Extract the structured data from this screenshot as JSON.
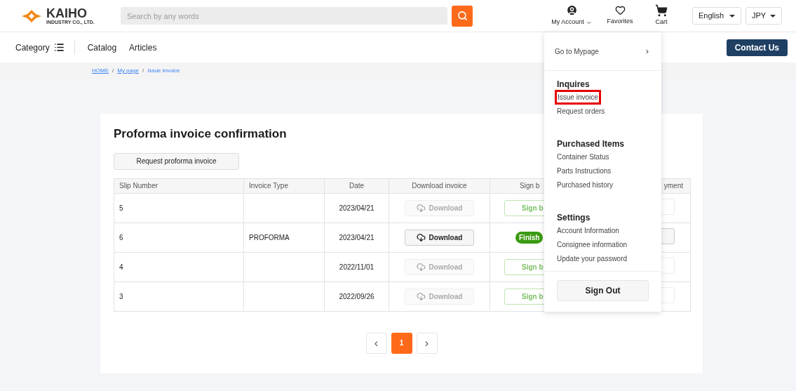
{
  "header": {
    "logo": {
      "name": "KAIHO",
      "subtitle": "INDUSTRY CO., LTD."
    },
    "search": {
      "placeholder": "Search by any words"
    },
    "account": {
      "label": "My Account",
      "expanded": true
    },
    "favorites": {
      "label": "Favorites"
    },
    "cart": {
      "label": "Cart"
    },
    "language": "English",
    "currency": "JPY"
  },
  "nav": {
    "category": "Category",
    "links": [
      "Catalog",
      "Articles"
    ],
    "contact": "Contact Us"
  },
  "breadcrumb_separator": "/",
  "breadcrumb": [
    {
      "label": "HOME",
      "link": true
    },
    {
      "label": "My page",
      "link": true
    },
    {
      "label": "Issue invoice",
      "link": false
    }
  ],
  "title": "Proforma invoice confirmation",
  "request_button": "Request proforma invoice",
  "table": {
    "columns": [
      "Slip Number",
      "Invoice Type",
      "Date",
      "Download invoice",
      "Sign b",
      "yment"
    ],
    "rows": [
      {
        "slip": "5",
        "type": "",
        "date": "2023/04/21",
        "download": {
          "label": "Download",
          "disabled": true
        },
        "sign": {
          "kind": "button",
          "label": "Sign b"
        },
        "payment_disabled": true
      },
      {
        "slip": "6",
        "type": "PROFORMA",
        "date": "2023/04/21",
        "download": {
          "label": "Download",
          "disabled": false
        },
        "sign": {
          "kind": "badge",
          "label": "Finish"
        },
        "payment_disabled": false
      },
      {
        "slip": "4",
        "type": "",
        "date": "2022/11/01",
        "download": {
          "label": "Download",
          "disabled": true
        },
        "sign": {
          "kind": "button",
          "label": "Sign b"
        },
        "payment_disabled": true
      },
      {
        "slip": "3",
        "type": "",
        "date": "2022/09/26",
        "download": {
          "label": "Download",
          "disabled": true
        },
        "sign": {
          "kind": "button",
          "label": "Sign b"
        },
        "payment_disabled": true
      }
    ]
  },
  "pagination": {
    "prev": "‹",
    "pages": [
      {
        "label": "1",
        "selected": true
      }
    ],
    "next": "›"
  },
  "menu": {
    "top": {
      "label": "Go to Mypage",
      "arrow": "›"
    },
    "sections": [
      {
        "title": "Inquires",
        "items": [
          {
            "label": "Issue invoice",
            "highlighted": true
          },
          {
            "label": "Request orders",
            "highlighted": false
          }
        ]
      },
      {
        "title": "Purchased Items",
        "items": [
          {
            "label": "Container Status",
            "highlighted": false
          },
          {
            "label": "Parts Instructions",
            "highlighted": false
          },
          {
            "label": "Purchased history",
            "highlighted": false
          }
        ]
      },
      {
        "title": "Settings",
        "items": [
          {
            "label": "Account Information",
            "highlighted": false
          },
          {
            "label": "Consignee information",
            "highlighted": false
          },
          {
            "label": "Update your password",
            "highlighted": false
          }
        ]
      }
    ],
    "sign_out": "Sign Out"
  }
}
